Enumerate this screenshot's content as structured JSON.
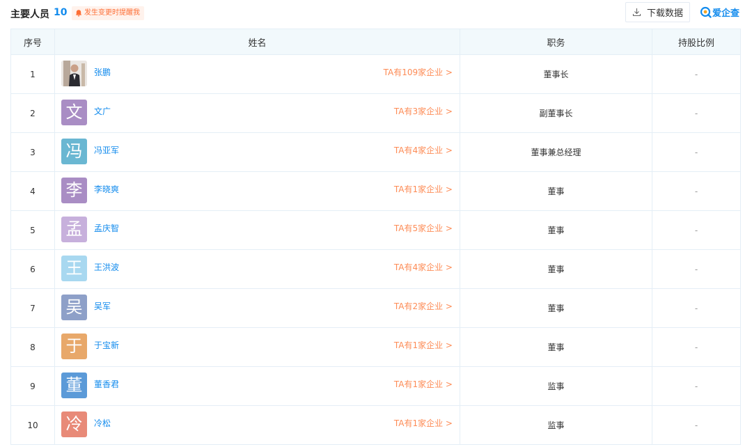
{
  "section": {
    "title": "主要人员",
    "count": "10",
    "notify_label": "发生变更时提醒我",
    "download_label": "下载数据",
    "logo_text": "爱企查"
  },
  "colors": {
    "accent": "#128bed",
    "link_orange": "#fd8b55",
    "header_bg": "#f2f9fc"
  },
  "table": {
    "headers": [
      "序号",
      "姓名",
      "职务",
      "持股比例"
    ],
    "rows": [
      {
        "index": "1",
        "avatar": "",
        "name": "张鹏",
        "link": "TA有109家企业 >",
        "role": "董事长",
        "share": "-"
      },
      {
        "index": "2",
        "avatar": "文",
        "avatar_color": "#a98dc4",
        "name": "文广",
        "link": "TA有3家企业 >",
        "role": "副董事长",
        "share": "-"
      },
      {
        "index": "3",
        "avatar": "冯",
        "avatar_color": "#6ab7d2",
        "name": "冯亚军",
        "link": "TA有4家企业 >",
        "role": "董事兼总经理",
        "share": "-"
      },
      {
        "index": "4",
        "avatar": "李",
        "avatar_color": "#a98dc4",
        "name": "李晓爽",
        "link": "TA有1家企业 >",
        "role": "董事",
        "share": "-"
      },
      {
        "index": "5",
        "avatar": "孟",
        "avatar_color": "#c7b0dc",
        "name": "孟庆智",
        "link": "TA有5家企业 >",
        "role": "董事",
        "share": "-"
      },
      {
        "index": "6",
        "avatar": "王",
        "avatar_color": "#a8d8f0",
        "name": "王洪波",
        "link": "TA有4家企业 >",
        "role": "董事",
        "share": "-"
      },
      {
        "index": "7",
        "avatar": "吴",
        "avatar_color": "#8ea0c8",
        "name": "吴军",
        "link": "TA有2家企业 >",
        "role": "董事",
        "share": "-"
      },
      {
        "index": "8",
        "avatar": "于",
        "avatar_color": "#e8a86a",
        "name": "于宝新",
        "link": "TA有1家企业 >",
        "role": "董事",
        "share": "-"
      },
      {
        "index": "9",
        "avatar": "董",
        "avatar_color": "#5b9ad8",
        "name": "董香君",
        "link": "TA有1家企业 >",
        "role": "监事",
        "share": "-"
      },
      {
        "index": "10",
        "avatar": "冷",
        "avatar_color": "#e88a78",
        "name": "冷松",
        "link": "TA有1家企业 >",
        "role": "监事",
        "share": "-"
      }
    ]
  }
}
